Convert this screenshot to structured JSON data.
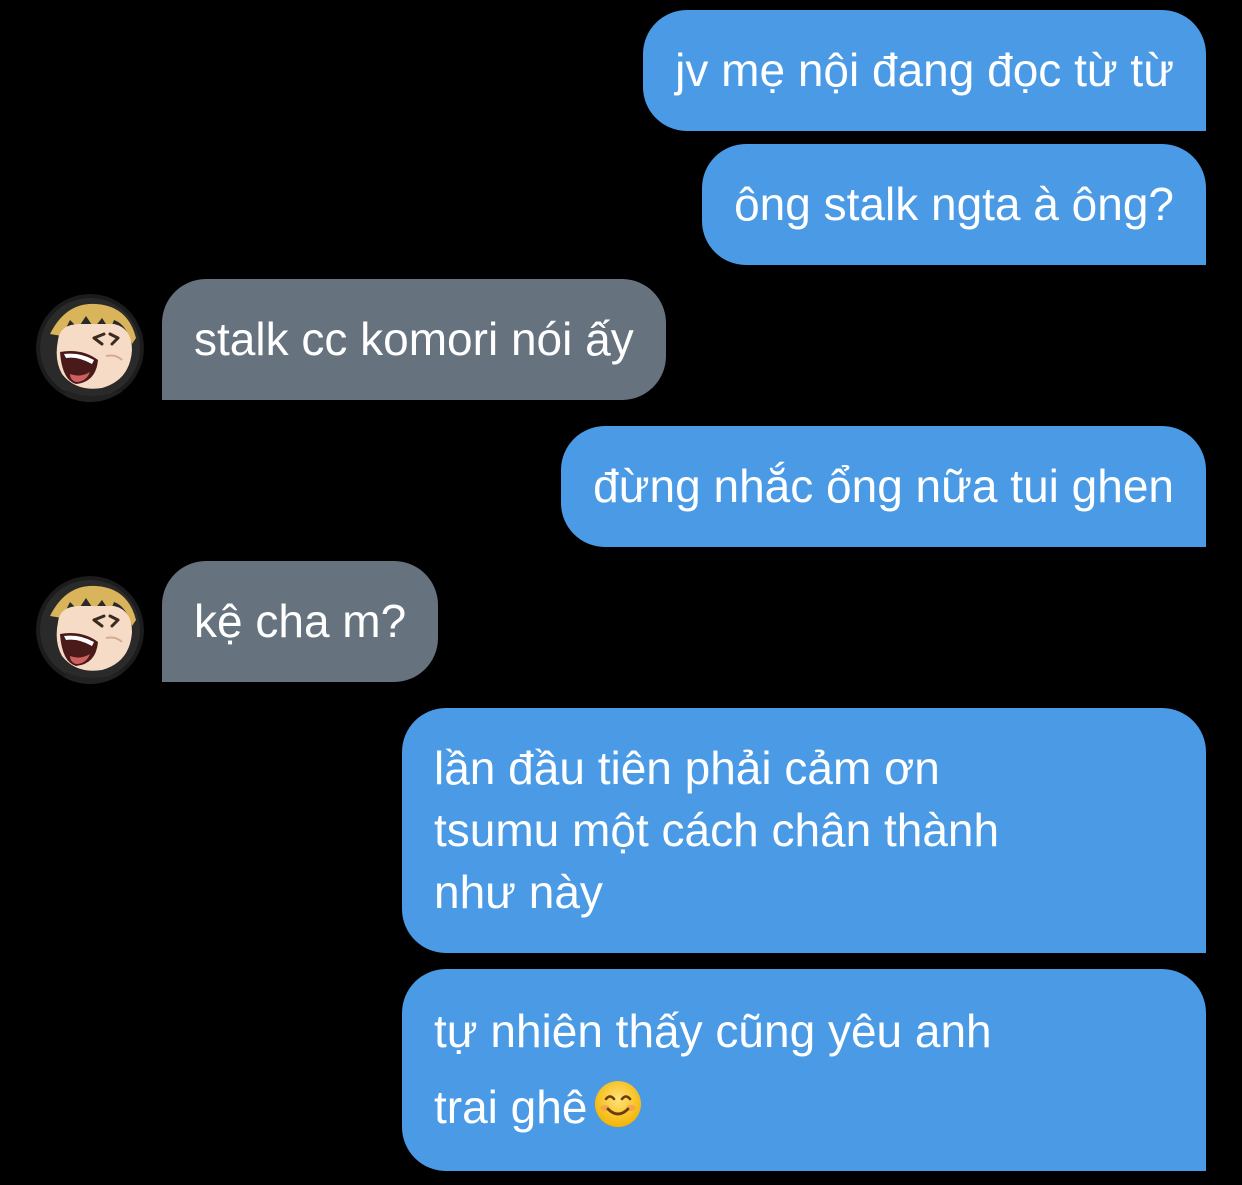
{
  "messages": [
    {
      "direction": "outgoing",
      "text": "jv mẹ nội đang đọc từ từ"
    },
    {
      "direction": "outgoing",
      "text": "ông stalk ngta à ông?"
    },
    {
      "direction": "incoming",
      "text": "stalk cc komori nói ấy"
    },
    {
      "direction": "outgoing",
      "text": "đừng nhắc ổng nữa tui ghen"
    },
    {
      "direction": "incoming",
      "text": "kệ cha m?"
    },
    {
      "direction": "outgoing",
      "lines": [
        "lần đầu tiên phải cảm ơn",
        "tsumu một cách chân thành",
        "như này"
      ]
    },
    {
      "direction": "outgoing",
      "lines": [
        "tự nhiên thấy cũng yêu anh",
        "trai ghê"
      ],
      "emoji": "smiling-face-icon"
    }
  ],
  "colors": {
    "background": "#000000",
    "outgoing_bubble": "#4a9ae6",
    "incoming_bubble": "#66737f",
    "text": "#ffffff"
  },
  "icons": {
    "avatar": "anime-avatar-blond-laughing"
  }
}
